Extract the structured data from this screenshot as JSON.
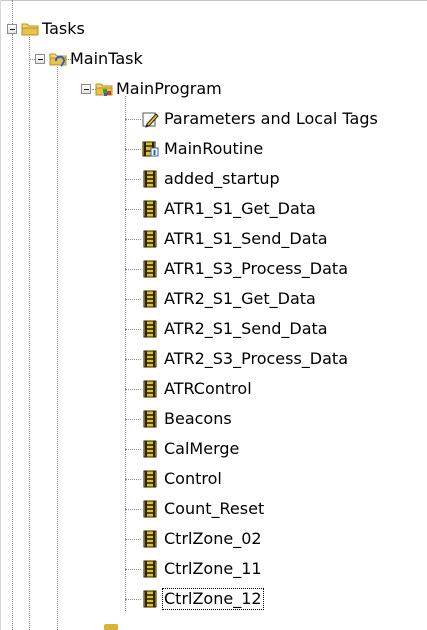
{
  "tree": {
    "root": {
      "label": "Tasks",
      "icon": "folder-icon",
      "expanded": true
    },
    "task": {
      "label": "MainTask",
      "icon": "task-folder-icon",
      "expanded": true
    },
    "program": {
      "label": "MainProgram",
      "icon": "program-folder-icon",
      "expanded": true
    },
    "items": [
      {
        "label": "Parameters and Local Tags",
        "icon": "tags-pencil-icon"
      },
      {
        "label": "MainRoutine",
        "icon": "main-routine-icon"
      },
      {
        "label": "added_startup",
        "icon": "ladder-routine-icon"
      },
      {
        "label": "ATR1_S1_Get_Data",
        "icon": "ladder-routine-icon"
      },
      {
        "label": "ATR1_S1_Send_Data",
        "icon": "ladder-routine-icon"
      },
      {
        "label": "ATR1_S3_Process_Data",
        "icon": "ladder-routine-icon"
      },
      {
        "label": "ATR2_S1_Get_Data",
        "icon": "ladder-routine-icon"
      },
      {
        "label": "ATR2_S1_Send_Data",
        "icon": "ladder-routine-icon"
      },
      {
        "label": "ATR2_S3_Process_Data",
        "icon": "ladder-routine-icon"
      },
      {
        "label": "ATRControl",
        "icon": "ladder-routine-icon"
      },
      {
        "label": "Beacons",
        "icon": "ladder-routine-icon"
      },
      {
        "label": "CalMerge",
        "icon": "ladder-routine-icon"
      },
      {
        "label": "Control",
        "icon": "ladder-routine-icon"
      },
      {
        "label": "Count_Reset",
        "icon": "ladder-routine-icon"
      },
      {
        "label": "CtrlZone_02",
        "icon": "ladder-routine-icon"
      },
      {
        "label": "CtrlZone_11",
        "icon": "ladder-routine-icon"
      },
      {
        "label": "CtrlZone_12",
        "icon": "ladder-routine-icon",
        "selected": true
      }
    ]
  },
  "colors": {
    "folder": "#e8c24a",
    "folder_dark": "#b8901c",
    "routine": "#e0c21e",
    "routine_dark": "#2a2200",
    "task_arrow": "#2a5fc8",
    "program_green": "#3a9a3a",
    "program_red": "#c83a2a",
    "tree_line": "#8a8a8a"
  }
}
